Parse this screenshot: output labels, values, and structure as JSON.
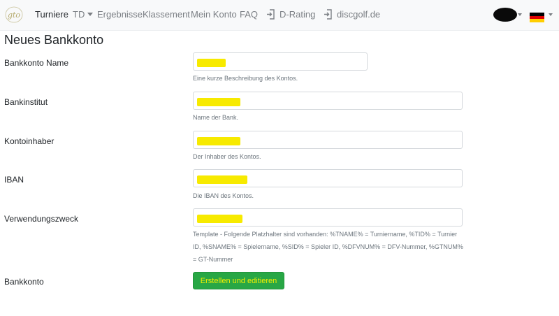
{
  "navbar": {
    "logo_text": "gto",
    "items": [
      {
        "label": "Turniere"
      },
      {
        "label": "TD"
      },
      {
        "label": "Ergebnisse"
      },
      {
        "label": "Klassement"
      },
      {
        "label": "Mein Konto"
      },
      {
        "label": "FAQ"
      },
      {
        "label": "D-Rating"
      },
      {
        "label": "discgolf.de"
      }
    ]
  },
  "page": {
    "title": "Neues Bankkonto"
  },
  "form": {
    "fields": [
      {
        "label": "Bankkonto Name",
        "value": "",
        "help": "Eine kurze Beschreibung des Kontos."
      },
      {
        "label": "Bankinstitut",
        "value": "",
        "help": "Name der Bank."
      },
      {
        "label": "Kontoinhaber",
        "value": "",
        "help": "Der Inhaber des Kontos."
      },
      {
        "label": "IBAN",
        "value": "",
        "help": "Die IBAN des Kontos."
      },
      {
        "label": "Verwendungszweck",
        "value": "",
        "help_lines": [
          "Template - Folgende Platzhalter sind vorhanden: %TNAME% = Turniername, %TID% = Turnier",
          "ID, %SNAME% = Spielername, %SID% = Spieler ID, %DFVNUM% = DFV-Nummer, %GTNUM%",
          "= GT-Nummer"
        ]
      }
    ],
    "submit": {
      "label": "Bankkonto",
      "button": "Erstellen und editieren"
    }
  },
  "colors": {
    "navbar_bg": "#f8f9fa",
    "button_green": "#28a745",
    "highlight_yellow": "#f7ea00"
  }
}
